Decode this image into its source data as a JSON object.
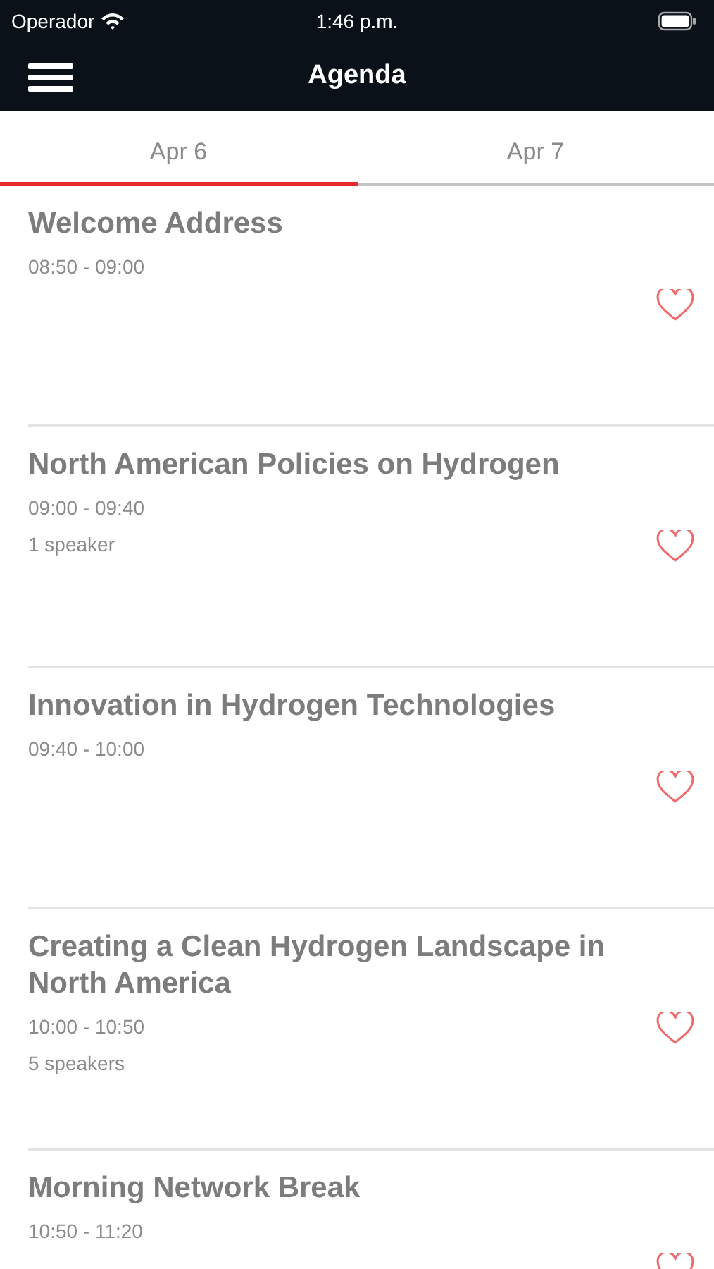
{
  "status_bar": {
    "carrier": "Operador",
    "time": "1:46 p.m."
  },
  "nav_bar": {
    "title": "Agenda"
  },
  "tabs": [
    {
      "label": "Apr 6",
      "selected": true
    },
    {
      "label": "Apr 7",
      "selected": false
    }
  ],
  "sessions": [
    {
      "title": "Welcome Address",
      "time": "08:50 - 09:00",
      "favorite": false
    },
    {
      "title": "North American Policies on Hydrogen",
      "time": "09:00 - 09:40",
      "speakers": "1 speaker",
      "favorite": false
    },
    {
      "title": "Innovation in Hydrogen Technologies",
      "time": "09:40 - 10:00",
      "favorite": false
    },
    {
      "title": "Creating a Clean Hydrogen Landscape in North America",
      "time": "10:00 - 10:50",
      "speakers": "5 speakers",
      "favorite": false
    },
    {
      "title": "Morning Network Break",
      "time": "10:50 - 11:20",
      "favorite": false
    }
  ]
}
